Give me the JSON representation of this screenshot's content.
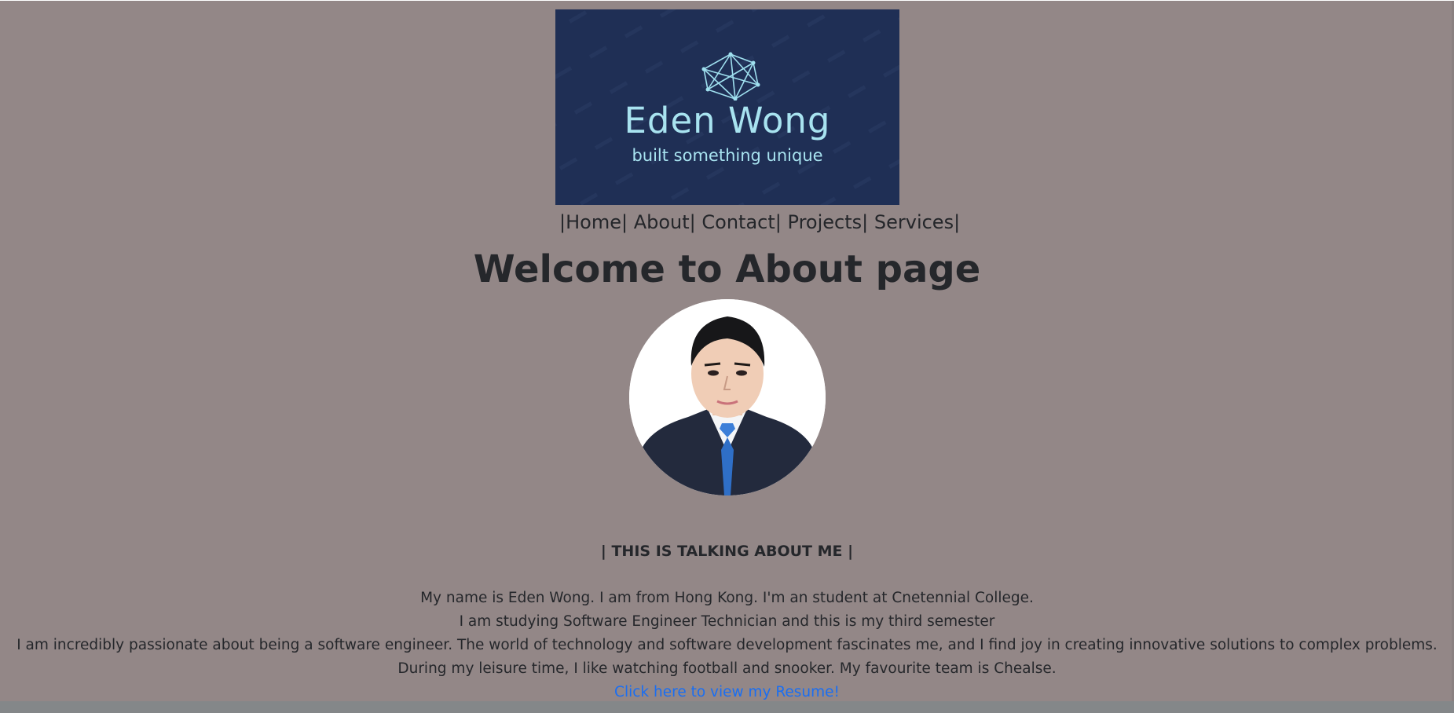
{
  "logo": {
    "name": "Eden Wong",
    "tagline": "built something unique",
    "colors": {
      "background": "#1f2f55",
      "text": "#a8e3f0"
    },
    "icon": "network-polygon-icon"
  },
  "nav": {
    "separator": "|",
    "items": [
      {
        "label": "Home"
      },
      {
        "label": "About"
      },
      {
        "label": "Contact"
      },
      {
        "label": "Projects"
      },
      {
        "label": "Services"
      }
    ]
  },
  "main": {
    "title": "Welcome to About page",
    "section_heading": "| THIS IS TALKING ABOUT ME |",
    "bio": [
      "My name is Eden Wong. I am from Hong Kong. I'm an student at Cnetennial College.",
      "I am studying Software Engineer Technician and this is my third semester",
      "I am incredibly passionate about being a software engineer. The world of technology and software development fascinates me, and I find joy in creating innovative solutions to complex problems.",
      "During my leisure time, I like watching football and snooker. My favourite team is Chealse."
    ],
    "resume_link": "Click here to view my Resume!"
  },
  "colors": {
    "page_background": "#938787",
    "text": "#25272b",
    "link": "#1a6ef2"
  }
}
